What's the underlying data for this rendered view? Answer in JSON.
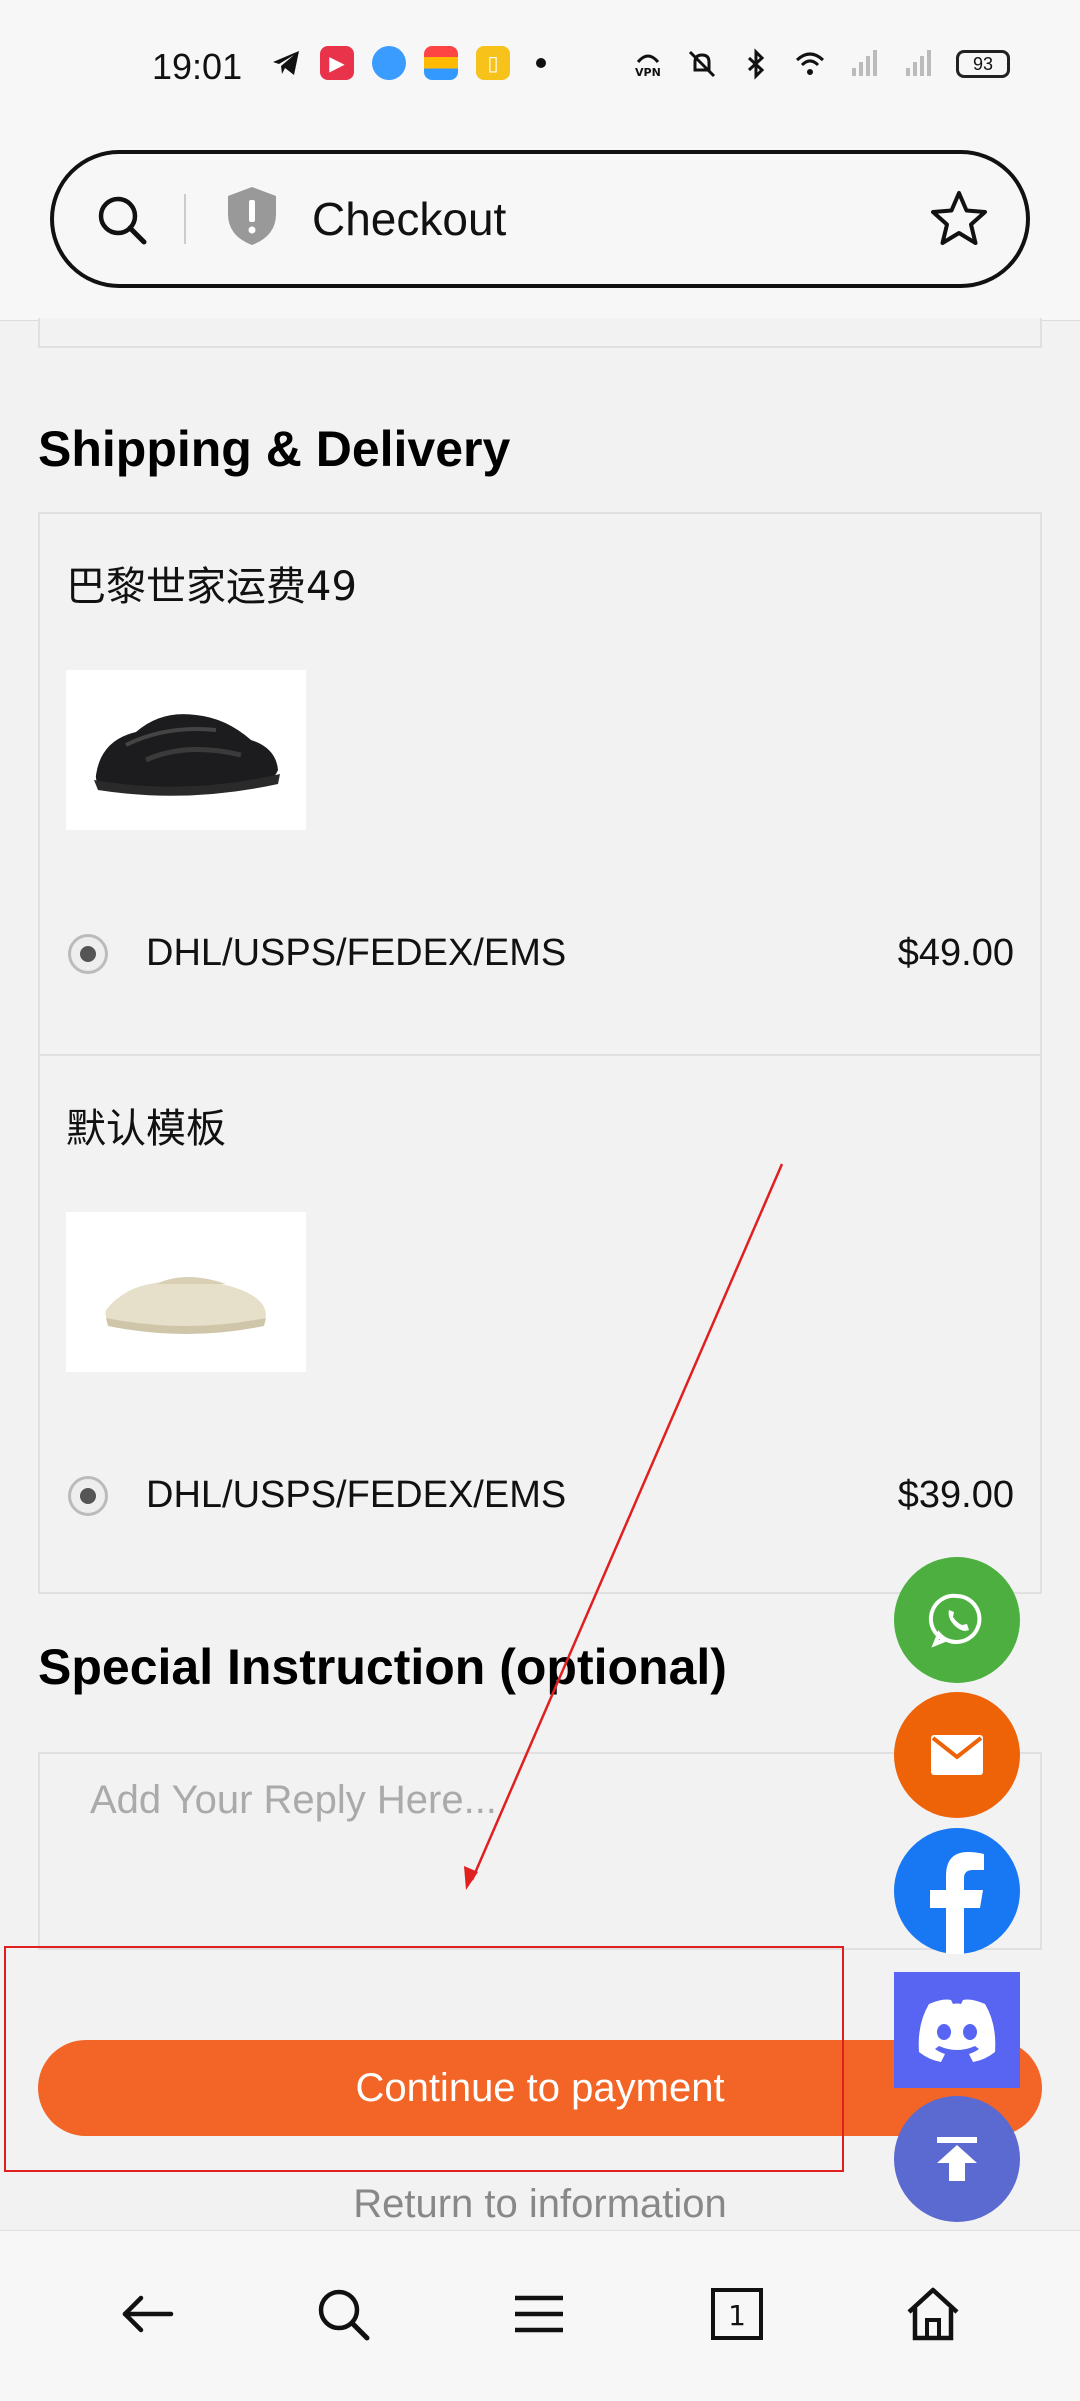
{
  "status_bar": {
    "time": "19:01",
    "battery": "93"
  },
  "browser": {
    "title": "Checkout"
  },
  "sections": {
    "shipping_title": "Shipping & Delivery",
    "special_title": "Special Instruction (optional)"
  },
  "shipping_items": [
    {
      "name": "巴黎世家运费49",
      "method": "DHL/USPS/FEDEX/EMS",
      "price": "$49.00",
      "product": "black sneaker"
    },
    {
      "name": "默认模板",
      "method": "DHL/USPS/FEDEX/EMS",
      "price": "$39.00",
      "product": "cream slide"
    }
  ],
  "instruction": {
    "placeholder": "Add Your Reply Here..."
  },
  "actions": {
    "continue_label": "Continue to payment",
    "return_label": "Return to information"
  },
  "floating": [
    "whatsapp-icon",
    "mail-icon",
    "facebook-icon",
    "discord-icon",
    "scroll-top-icon"
  ],
  "colors": {
    "accent": "#f26526",
    "annotation": "#e02020"
  }
}
